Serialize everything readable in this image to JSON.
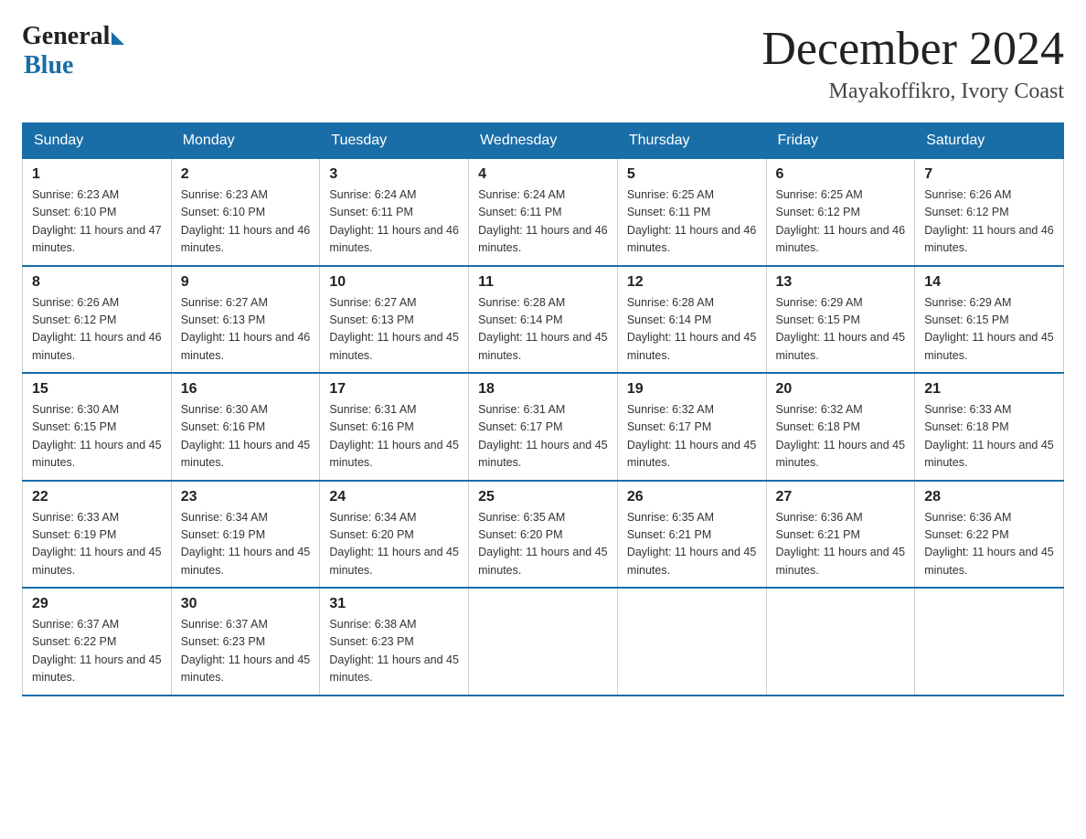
{
  "logo": {
    "general": "General",
    "blue": "Blue"
  },
  "title": {
    "month_year": "December 2024",
    "location": "Mayakoffikro, Ivory Coast"
  },
  "headers": [
    "Sunday",
    "Monday",
    "Tuesday",
    "Wednesday",
    "Thursday",
    "Friday",
    "Saturday"
  ],
  "weeks": [
    [
      {
        "day": "1",
        "sunrise": "6:23 AM",
        "sunset": "6:10 PM",
        "daylight": "11 hours and 47 minutes."
      },
      {
        "day": "2",
        "sunrise": "6:23 AM",
        "sunset": "6:10 PM",
        "daylight": "11 hours and 46 minutes."
      },
      {
        "day": "3",
        "sunrise": "6:24 AM",
        "sunset": "6:11 PM",
        "daylight": "11 hours and 46 minutes."
      },
      {
        "day": "4",
        "sunrise": "6:24 AM",
        "sunset": "6:11 PM",
        "daylight": "11 hours and 46 minutes."
      },
      {
        "day": "5",
        "sunrise": "6:25 AM",
        "sunset": "6:11 PM",
        "daylight": "11 hours and 46 minutes."
      },
      {
        "day": "6",
        "sunrise": "6:25 AM",
        "sunset": "6:12 PM",
        "daylight": "11 hours and 46 minutes."
      },
      {
        "day": "7",
        "sunrise": "6:26 AM",
        "sunset": "6:12 PM",
        "daylight": "11 hours and 46 minutes."
      }
    ],
    [
      {
        "day": "8",
        "sunrise": "6:26 AM",
        "sunset": "6:12 PM",
        "daylight": "11 hours and 46 minutes."
      },
      {
        "day": "9",
        "sunrise": "6:27 AM",
        "sunset": "6:13 PM",
        "daylight": "11 hours and 46 minutes."
      },
      {
        "day": "10",
        "sunrise": "6:27 AM",
        "sunset": "6:13 PM",
        "daylight": "11 hours and 45 minutes."
      },
      {
        "day": "11",
        "sunrise": "6:28 AM",
        "sunset": "6:14 PM",
        "daylight": "11 hours and 45 minutes."
      },
      {
        "day": "12",
        "sunrise": "6:28 AM",
        "sunset": "6:14 PM",
        "daylight": "11 hours and 45 minutes."
      },
      {
        "day": "13",
        "sunrise": "6:29 AM",
        "sunset": "6:15 PM",
        "daylight": "11 hours and 45 minutes."
      },
      {
        "day": "14",
        "sunrise": "6:29 AM",
        "sunset": "6:15 PM",
        "daylight": "11 hours and 45 minutes."
      }
    ],
    [
      {
        "day": "15",
        "sunrise": "6:30 AM",
        "sunset": "6:15 PM",
        "daylight": "11 hours and 45 minutes."
      },
      {
        "day": "16",
        "sunrise": "6:30 AM",
        "sunset": "6:16 PM",
        "daylight": "11 hours and 45 minutes."
      },
      {
        "day": "17",
        "sunrise": "6:31 AM",
        "sunset": "6:16 PM",
        "daylight": "11 hours and 45 minutes."
      },
      {
        "day": "18",
        "sunrise": "6:31 AM",
        "sunset": "6:17 PM",
        "daylight": "11 hours and 45 minutes."
      },
      {
        "day": "19",
        "sunrise": "6:32 AM",
        "sunset": "6:17 PM",
        "daylight": "11 hours and 45 minutes."
      },
      {
        "day": "20",
        "sunrise": "6:32 AM",
        "sunset": "6:18 PM",
        "daylight": "11 hours and 45 minutes."
      },
      {
        "day": "21",
        "sunrise": "6:33 AM",
        "sunset": "6:18 PM",
        "daylight": "11 hours and 45 minutes."
      }
    ],
    [
      {
        "day": "22",
        "sunrise": "6:33 AM",
        "sunset": "6:19 PM",
        "daylight": "11 hours and 45 minutes."
      },
      {
        "day": "23",
        "sunrise": "6:34 AM",
        "sunset": "6:19 PM",
        "daylight": "11 hours and 45 minutes."
      },
      {
        "day": "24",
        "sunrise": "6:34 AM",
        "sunset": "6:20 PM",
        "daylight": "11 hours and 45 minutes."
      },
      {
        "day": "25",
        "sunrise": "6:35 AM",
        "sunset": "6:20 PM",
        "daylight": "11 hours and 45 minutes."
      },
      {
        "day": "26",
        "sunrise": "6:35 AM",
        "sunset": "6:21 PM",
        "daylight": "11 hours and 45 minutes."
      },
      {
        "day": "27",
        "sunrise": "6:36 AM",
        "sunset": "6:21 PM",
        "daylight": "11 hours and 45 minutes."
      },
      {
        "day": "28",
        "sunrise": "6:36 AM",
        "sunset": "6:22 PM",
        "daylight": "11 hours and 45 minutes."
      }
    ],
    [
      {
        "day": "29",
        "sunrise": "6:37 AM",
        "sunset": "6:22 PM",
        "daylight": "11 hours and 45 minutes."
      },
      {
        "day": "30",
        "sunrise": "6:37 AM",
        "sunset": "6:23 PM",
        "daylight": "11 hours and 45 minutes."
      },
      {
        "day": "31",
        "sunrise": "6:38 AM",
        "sunset": "6:23 PM",
        "daylight": "11 hours and 45 minutes."
      },
      null,
      null,
      null,
      null
    ]
  ]
}
